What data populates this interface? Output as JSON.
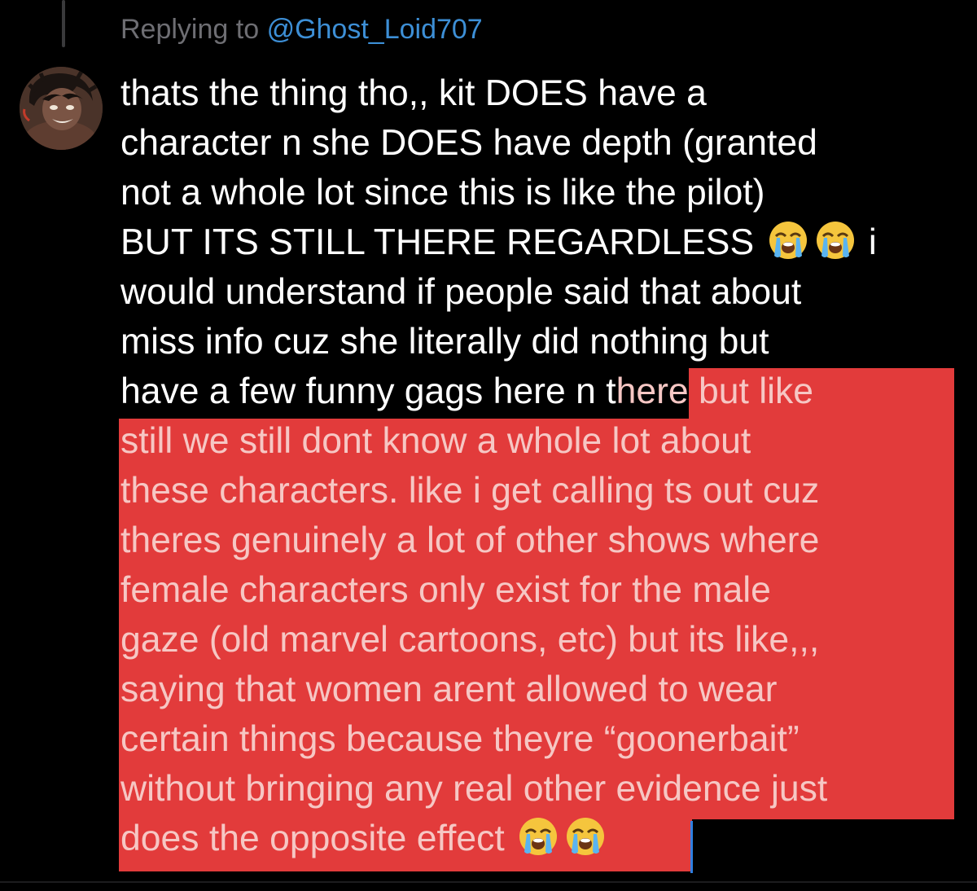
{
  "reply": {
    "prefix": "Replying to",
    "handle": "@Ghost_Loid707"
  },
  "avatar": {
    "icon": "user-avatar-icon"
  },
  "tweet": {
    "lines": [
      "thats the thing tho,, kit DOES have a",
      "character n she DOES have depth (granted",
      "not a whole lot since this is like the pilot)",
      "BUT ITS STILL THERE REGARDLESS",
      "i",
      "would understand if people said that about",
      "miss info cuz she literally did nothing but",
      "have a few funny gags here n t",
      "here but like",
      "still we still dont know a whole lot about",
      "these characters. like i get calling ts out cuz",
      "theres genuinely a lot of other shows where",
      "female characters only exist for the male",
      "gaze (old marvel cartoons, etc) but its like,,,",
      "saying that women arent allowed to wear",
      "certain things because theyre “goonerbait”",
      "without bringing any real other evidence just",
      "does the opposite effect"
    ],
    "emoji": "loudly-crying-face-icon"
  },
  "colors": {
    "background": "#000000",
    "text": "#ffffff",
    "muted": "#6e6e73",
    "handle": "#3d8fd6",
    "highlight": "#e23b3b",
    "highlight_text": "#f6c7c4",
    "caret": "#2f7fe0"
  }
}
